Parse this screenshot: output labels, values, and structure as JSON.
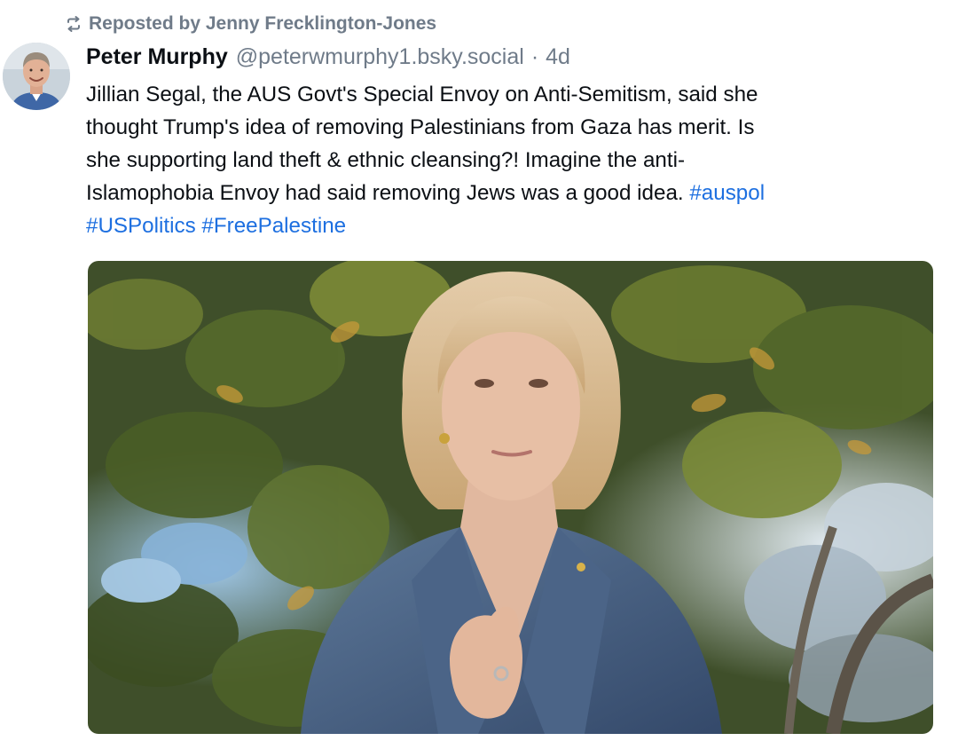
{
  "repost": {
    "icon": "repost-icon",
    "label": "Reposted by Jenny Frecklington-Jones"
  },
  "post": {
    "avatar_icon": "avatar",
    "author_name": "Peter Murphy",
    "author_handle": "@peterwmurphy1.bsky.social",
    "separator": "·",
    "timestamp": "4d",
    "text_lines": [
      "Jillian Segal, the AUS Govt's Special Envoy on Anti-Semitism, said she",
      "thought Trump's idea of removing Palestinians from Gaza has merit. Is",
      "she supporting land theft & ethnic cleansing?! Imagine the anti-",
      "Islamophobia Envoy had said removing Jews was a good idea. "
    ],
    "hashtags": {
      "auspol": "#auspol",
      "uspolitics": "#USPolitics",
      "freepalestine": "#FreePalestine"
    },
    "image_description": "photo-woman-in-blue-blazer-before-magnolia-tree"
  },
  "colors": {
    "muted": "#6f7b89",
    "link": "#1d6fe0",
    "text": "#0b0f14"
  }
}
